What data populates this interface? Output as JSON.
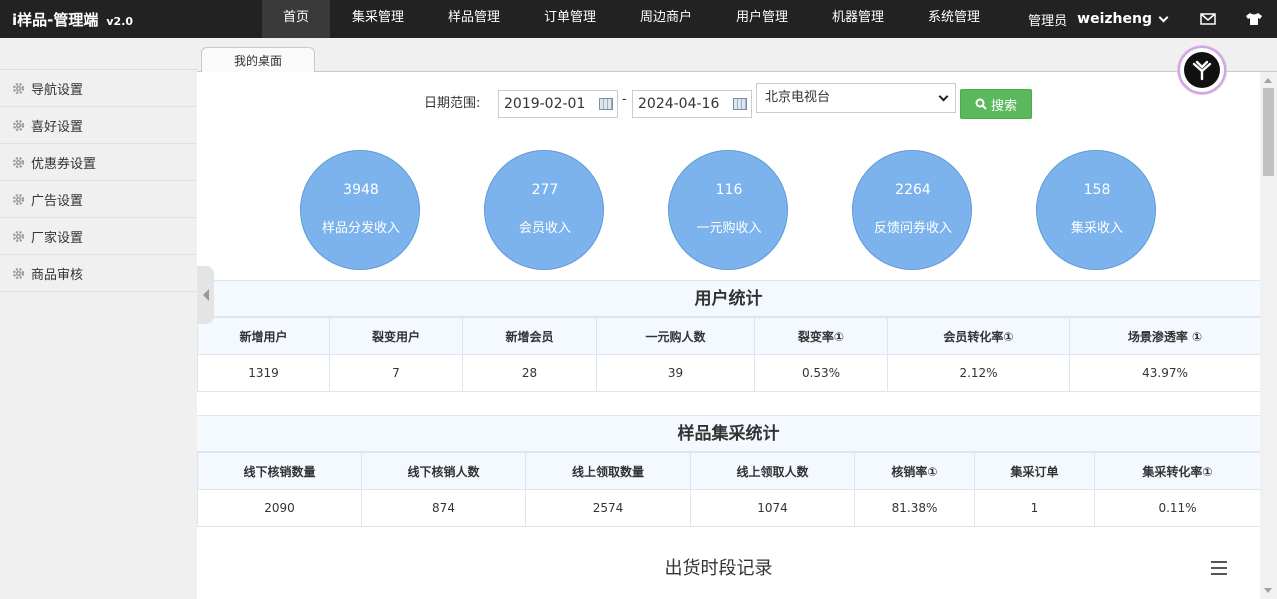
{
  "app": {
    "title": "i样品-管理端",
    "version": "v2.0"
  },
  "nav": {
    "items": [
      "首页",
      "集采管理",
      "样品管理",
      "订单管理",
      "周边商户",
      "用户管理",
      "机器管理",
      "系统管理"
    ],
    "active": "首页"
  },
  "user": {
    "role": "管理员",
    "name": "weizheng"
  },
  "header_icons": [
    "mail-icon",
    "tshirt-icon"
  ],
  "sidebar": {
    "items": [
      "导航设置",
      "喜好设置",
      "优惠券设置",
      "广告设置",
      "厂家设置",
      "商品审核"
    ]
  },
  "tabs": {
    "active_tab": "我的桌面"
  },
  "filters": {
    "date_label": "日期范围:",
    "start_date": "2019-02-01",
    "separator": "-",
    "end_date": "2024-04-16",
    "channel": "北京电视台",
    "search_label": "搜索"
  },
  "kpis": [
    {
      "value": "3948",
      "label": "样品分发收入"
    },
    {
      "value": "277",
      "label": "会员收入"
    },
    {
      "value": "116",
      "label": "一元购收入"
    },
    {
      "value": "2264",
      "label": "反馈问券收入"
    },
    {
      "value": "158",
      "label": "集采收入"
    }
  ],
  "user_stats": {
    "title": "用户统计",
    "headers": [
      "新增用户",
      "裂变用户",
      "新增会员",
      "一元购人数",
      "裂变率①",
      "会员转化率①",
      "场景渗透率 ①"
    ],
    "row": [
      "1319",
      "7",
      "28",
      "39",
      "0.53%",
      "2.12%",
      "43.97%"
    ]
  },
  "sample_stats": {
    "title": "样品集采统计",
    "headers": [
      "线下核销数量",
      "线下核销人数",
      "线上领取数量",
      "线上领取人数",
      "核销率①",
      "集采订单",
      "集采转化率①"
    ],
    "row": [
      "2090",
      "874",
      "2574",
      "1074",
      "81.38%",
      "1",
      "0.11%"
    ]
  },
  "chart": {
    "title": "出货时段记录"
  },
  "colors": {
    "topbar": "#222222",
    "kpi_circle": "#7db3ec",
    "search_button": "#5cb85c",
    "table_header": "#f4f9ff"
  }
}
